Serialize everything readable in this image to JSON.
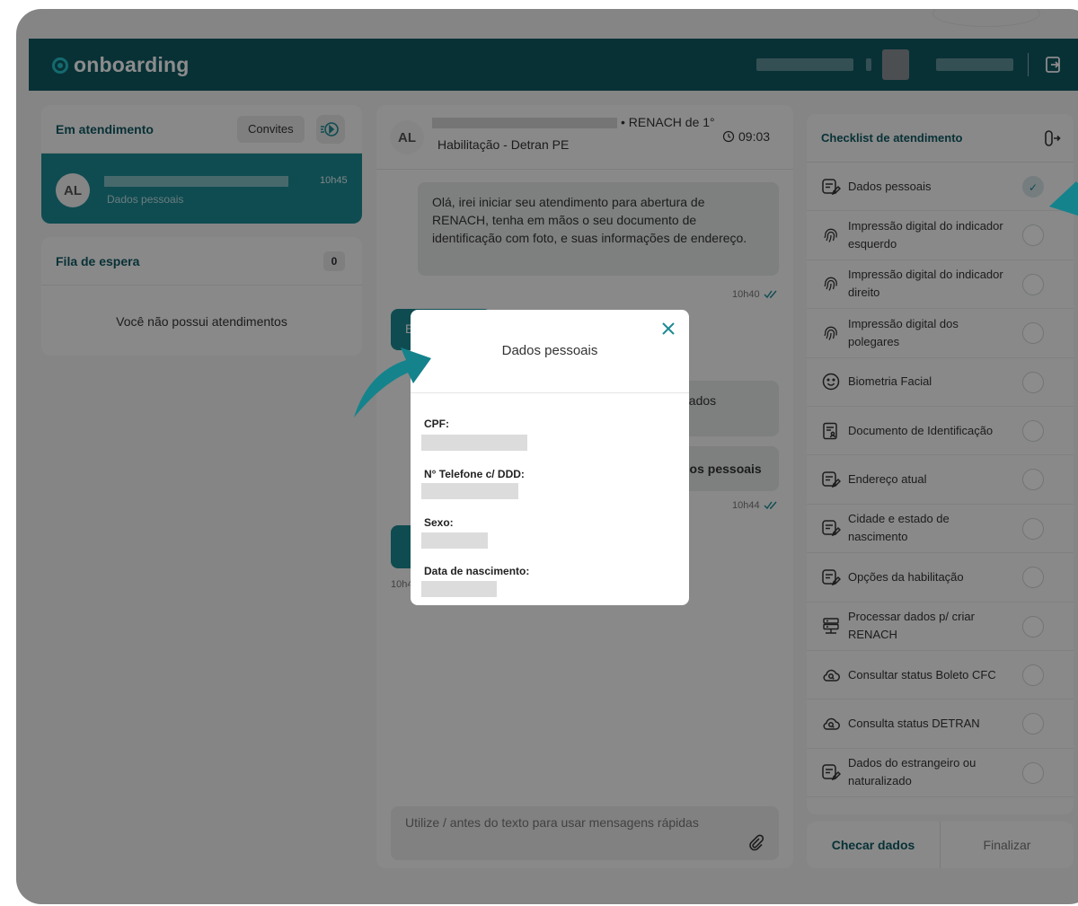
{
  "header": {
    "logo_text": "onboarding",
    "logout_icon": "logout-icon"
  },
  "in_service": {
    "title": "Em atendimento",
    "invites_label": "Convites",
    "active_item": {
      "initials": "AL",
      "time": "10h45",
      "subtitle": "Dados pessoais"
    }
  },
  "queue": {
    "title": "Fila de espera",
    "count": "0",
    "empty_text": "Você não possui atendimentos"
  },
  "chat": {
    "initials": "AL",
    "title_suffix": "• RENACH de 1°",
    "subtitle": "Habilitação - Detran PE",
    "time": "09:03",
    "message1": "Olá, irei iniciar seu atendimento para abertura de RENACH, tenha em mãos o seu documento de identificação com foto, e suas informações de endereço.",
    "message1_time": "10h40",
    "message3_partial": "dados",
    "message4_partial": "dos pessoais",
    "message4_time": "10h44",
    "message2_partial": "E",
    "message5_time_partial": "10h4",
    "input_placeholder": "Utilize / antes do texto para usar mensagens rápidas"
  },
  "checklist": {
    "title": "Checklist de atendimento",
    "items": [
      {
        "label": "Dados pessoais",
        "icon": "form-edit-icon",
        "done": true
      },
      {
        "label": "Impressão digital do indicador esquerdo",
        "icon": "fingerprint-icon",
        "done": false
      },
      {
        "label": "Impressão digital do indicador direito",
        "icon": "fingerprint-icon",
        "done": false
      },
      {
        "label": "Impressão digital dos polegares",
        "icon": "fingerprint-icon",
        "done": false
      },
      {
        "label": "Biometria Facial",
        "icon": "face-icon",
        "done": false
      },
      {
        "label": "Documento de Identificação",
        "icon": "id-document-icon",
        "done": false
      },
      {
        "label": "Endereço atual",
        "icon": "form-edit-icon",
        "done": false
      },
      {
        "label": "Cidade e estado de nascimento",
        "icon": "form-edit-icon",
        "done": false
      },
      {
        "label": "Opções da habilitação",
        "icon": "form-edit-icon",
        "done": false
      },
      {
        "label": "Processar dados p/ criar RENACH",
        "icon": "server-icon",
        "done": false
      },
      {
        "label": "Consultar status Boleto CFC",
        "icon": "cloud-search-icon",
        "done": false
      },
      {
        "label": "Consulta status DETRAN",
        "icon": "cloud-search-icon",
        "done": false
      },
      {
        "label": "Dados do estrangeiro ou naturalizado",
        "icon": "form-edit-icon",
        "done": false
      }
    ],
    "check_button": "Checar dados",
    "finish_button": "Finalizar"
  },
  "modal": {
    "title": "Dados pessoais",
    "fields": [
      {
        "label": "CPF:"
      },
      {
        "label": "N° Telefone c/ DDD:"
      },
      {
        "label": "Sexo:"
      },
      {
        "label": "Data de nascimento:"
      }
    ]
  },
  "colors": {
    "brand_dark": "#0f5a63",
    "brand_teal": "#1d8a94",
    "accent_arrow": "#14838c"
  }
}
